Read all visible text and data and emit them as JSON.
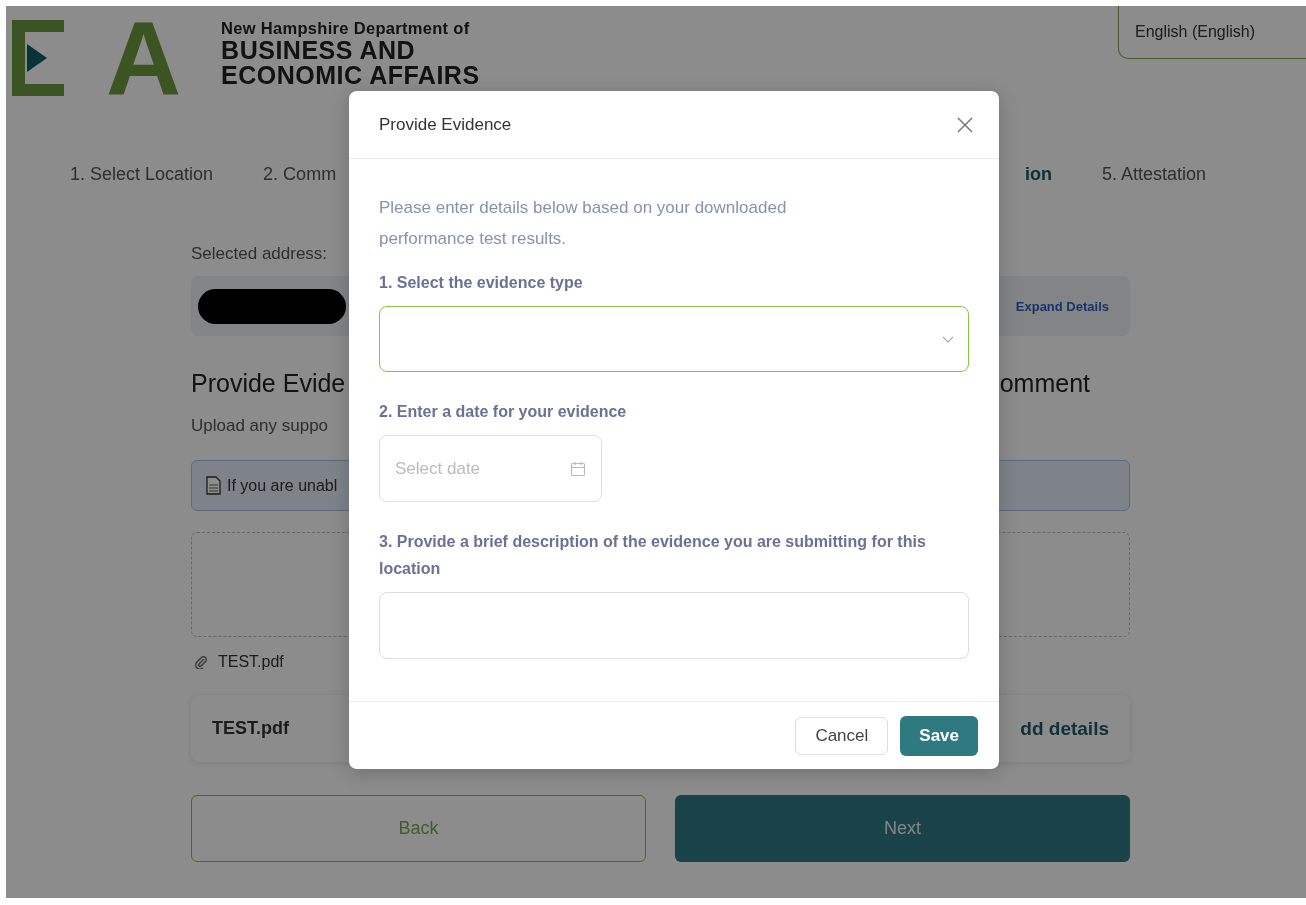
{
  "header": {
    "logo_letter": "A",
    "department_line": "New Hampshire Department of",
    "agency_lines": [
      "BUSINESS AND",
      "ECONOMIC AFFAIRS"
    ]
  },
  "language_selector": {
    "value": "English (English)"
  },
  "steps": [
    {
      "label": "1. Select Location",
      "selected": false
    },
    {
      "label": "2. Comm",
      "selected": false
    },
    {
      "label": "ion",
      "selected": true
    },
    {
      "label": "5. Attestation",
      "selected": false
    }
  ],
  "selected_address_label": "Selected address:",
  "address_card": {
    "expand_link": "Expand Details"
  },
  "section": {
    "heading_left": "Provide Evide",
    "heading_right": "omment",
    "description": "Upload any suppo",
    "info_note": "If you are unabl"
  },
  "attachment": {
    "name": "TEST.pdf"
  },
  "file_card": {
    "name": "TEST.pdf",
    "action": "dd details"
  },
  "buttons": [
    {
      "label": "Back",
      "kind": "secondary"
    },
    {
      "label": "Next",
      "kind": "primary"
    }
  ],
  "modal": {
    "title": "Provide Evidence",
    "intro": "Please enter details below based on your downloaded performance test results.",
    "fields": [
      {
        "kind": "select",
        "label": "1. Select the evidence type",
        "focused": true
      },
      {
        "kind": "date",
        "label": "2. Enter a date for your evidence",
        "placeholder": "Select date",
        "focused": false
      },
      {
        "kind": "textarea",
        "label": "3. Provide a brief description of the evidence you are submitting for this location",
        "focused": false
      }
    ],
    "buttons": [
      {
        "label": "Cancel",
        "kind": "secondary"
      },
      {
        "label": "Save",
        "kind": "primary"
      }
    ]
  }
}
